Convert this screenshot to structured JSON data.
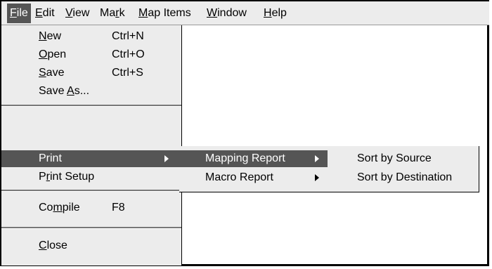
{
  "menubar": {
    "items": [
      {
        "pre": "",
        "u": "F",
        "post": "ile"
      },
      {
        "pre": "",
        "u": "E",
        "post": "dit"
      },
      {
        "pre": "",
        "u": "V",
        "post": "iew"
      },
      {
        "pre": "Ma",
        "u": "r",
        "post": "k"
      },
      {
        "pre": "",
        "u": "M",
        "post": "ap Items"
      },
      {
        "pre": "",
        "u": "W",
        "post": "indow"
      },
      {
        "pre": "",
        "u": "H",
        "post": "elp"
      }
    ]
  },
  "file_menu": {
    "items": [
      {
        "pre": "",
        "u": "N",
        "post": "ew",
        "shortcut": "Ctrl+N"
      },
      {
        "pre": "",
        "u": "O",
        "post": "pen",
        "shortcut": "Ctrl+O"
      },
      {
        "pre": "",
        "u": "S",
        "post": "ave",
        "shortcut": "Ctrl+S"
      },
      {
        "pre": "Save ",
        "u": "A",
        "post": "s...",
        "shortcut": ""
      },
      {
        "pre": "Print",
        "u": "",
        "post": "",
        "shortcut": ""
      },
      {
        "pre": "P",
        "u": "r",
        "post": "int Setup",
        "shortcut": ""
      },
      {
        "pre": "Co",
        "u": "m",
        "post": "pile",
        "shortcut": "F8"
      },
      {
        "pre": "",
        "u": "C",
        "post": "lose",
        "shortcut": ""
      }
    ]
  },
  "print_submenu": {
    "items": [
      {
        "label": "Mapping Report"
      },
      {
        "label": "Macro Report"
      }
    ]
  },
  "mapping_report_submenu": {
    "items": [
      {
        "label": "Sort by Source"
      },
      {
        "label": "Sort by Destination"
      }
    ]
  },
  "colors": {
    "menu_bg": "#ececec",
    "highlight_bg": "#555555",
    "highlight_text": "#ffffff"
  }
}
